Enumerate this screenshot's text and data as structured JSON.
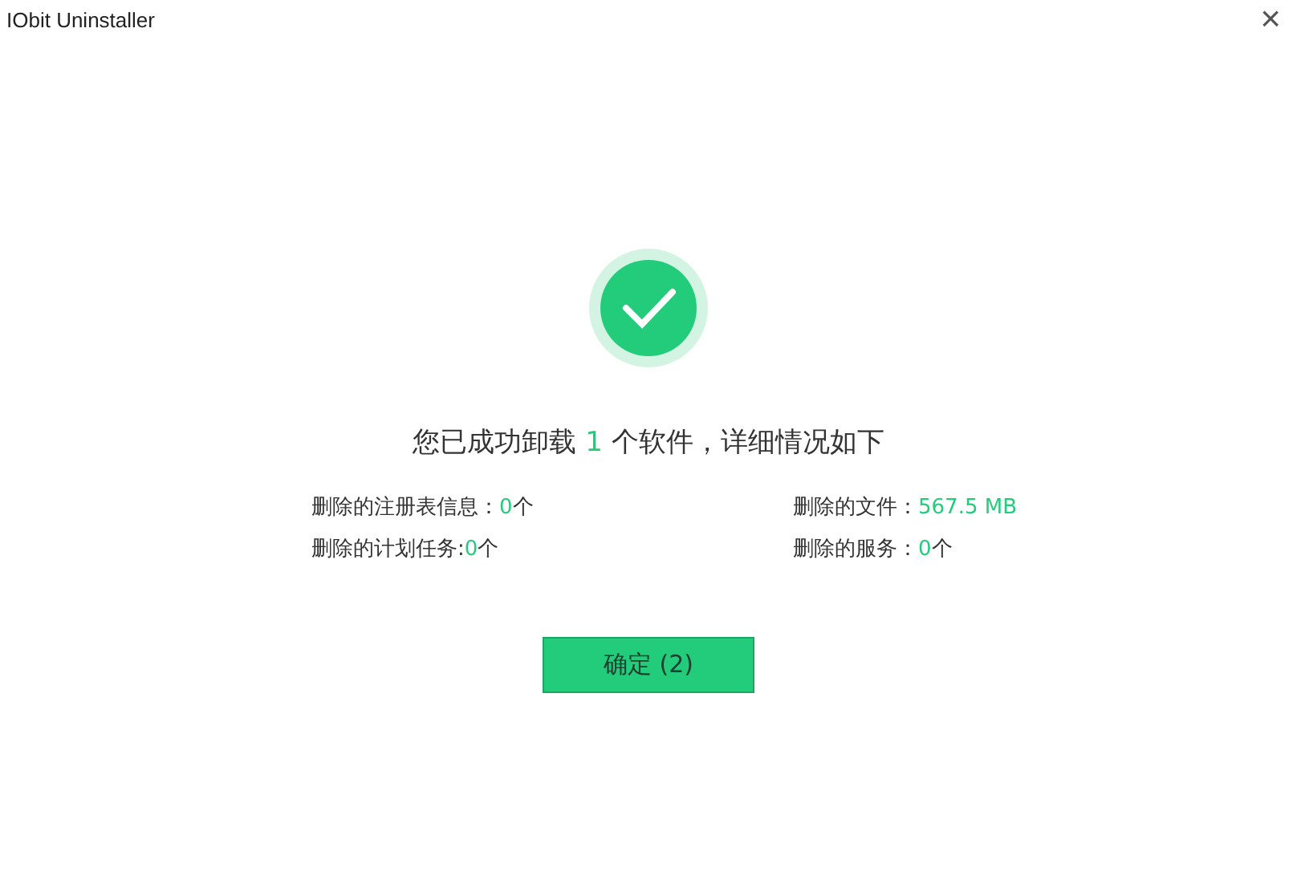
{
  "window": {
    "title": "IObit Uninstaller",
    "close_symbol": "×"
  },
  "result": {
    "before": "您已成功卸载",
    "count": "1",
    "after": "个软件，详细情况如下"
  },
  "stats": [
    {
      "label": "删除的注册表信息：",
      "value": "0",
      "unit": "个"
    },
    {
      "label": "删除的文件：",
      "value": "567.5 MB"
    },
    {
      "label": "删除的计划任务:",
      "value": "0",
      "unit": "个"
    },
    {
      "label": "删除的服务：",
      "value": "0",
      "unit": "个"
    }
  ],
  "button": {
    "label": "确定 (2)"
  }
}
